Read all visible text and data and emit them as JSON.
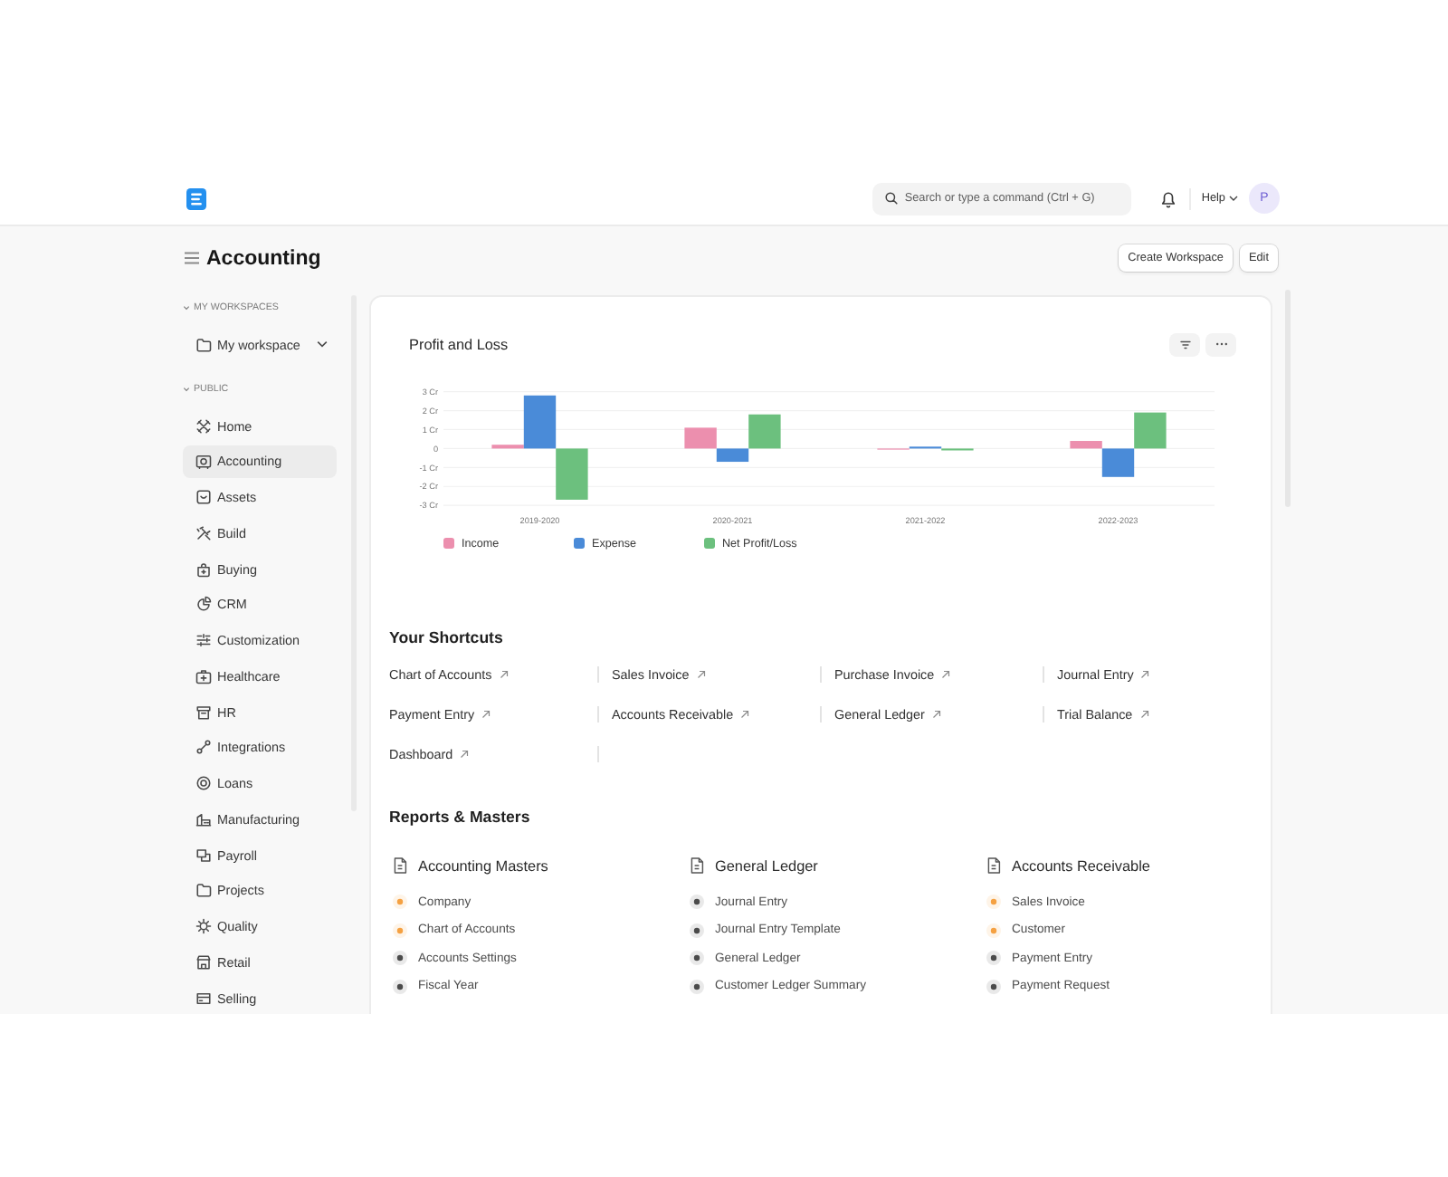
{
  "navbar": {
    "search": {
      "placeholder": "Search or type a command (Ctrl + G)"
    },
    "help": "Help",
    "avatar": "P"
  },
  "page_head": {
    "title": "Accounting",
    "buttons": [
      "Create Workspace",
      "Edit"
    ]
  },
  "sidebar": {
    "sections": [
      {
        "label": "MY WORKSPACES",
        "kind": "folders",
        "expanded": true,
        "items": [
          {
            "label": "My workspace",
            "selected": false,
            "expanded": false
          }
        ]
      },
      {
        "label": "PUBLIC",
        "kind": "modules",
        "expanded": true,
        "items": [
          {
            "label": "Home",
            "selected": false
          },
          {
            "label": "Accounting",
            "selected": true
          },
          {
            "label": "Assets",
            "selected": false
          },
          {
            "label": "Build",
            "selected": false
          },
          {
            "label": "Buying",
            "selected": false
          },
          {
            "label": "CRM",
            "selected": false
          },
          {
            "label": "Customization",
            "selected": false
          },
          {
            "label": "Healthcare",
            "selected": false
          },
          {
            "label": "HR",
            "selected": false
          },
          {
            "label": "Integrations",
            "selected": false
          },
          {
            "label": "Loans",
            "selected": false
          },
          {
            "label": "Manufacturing",
            "selected": false
          },
          {
            "label": "Payroll",
            "selected": false
          },
          {
            "label": "Projects",
            "selected": false
          },
          {
            "label": "Quality",
            "selected": false
          },
          {
            "label": "Retail",
            "selected": false
          },
          {
            "label": "Selling",
            "selected": false
          }
        ]
      }
    ]
  },
  "workspace": {
    "chart_widget": {
      "chart_data": {
        "type": "bar",
        "title": "Profit and Loss",
        "categories": [
          "2019-2020",
          "2020-2021",
          "2021-2022",
          "2022-2023"
        ],
        "series": [
          {
            "name": "Income",
            "color": "#ec8fae",
            "values": [
              0.2,
              1.1,
              0.0,
              0.4
            ]
          },
          {
            "name": "Expense",
            "color": "#4a8bd8",
            "values": [
              2.8,
              -0.7,
              0.1,
              -1.5
            ]
          },
          {
            "name": "Net Profit/Loss",
            "color": "#6cc07e",
            "values": [
              -2.7,
              1.8,
              -0.1,
              1.9
            ]
          }
        ],
        "ylim": [
          -3,
          3
        ],
        "yticks": [
          {
            "value": 3,
            "label": "3 Cr"
          },
          {
            "value": 2,
            "label": "2 Cr"
          },
          {
            "value": 1,
            "label": "1 Cr"
          },
          0,
          {
            "value": -1,
            "label": "-1 Cr"
          },
          {
            "value": -2,
            "label": "-2 Cr"
          },
          {
            "value": -3,
            "label": "-3 Cr"
          }
        ],
        "grid": true
      }
    },
    "shortcuts": {
      "title": "Your Shortcuts",
      "items": [
        "Chart of Accounts",
        "Sales Invoice",
        "Purchase Invoice",
        "Journal Entry",
        "Payment Entry",
        "Accounts Receivable",
        "General Ledger",
        "Trial Balance",
        "Dashboard"
      ]
    },
    "reports": {
      "title": "Reports & Masters",
      "cards": [
        {
          "title": "Accounting Masters",
          "links": [
            {
              "label": "Company",
              "color": "#f5a142"
            },
            {
              "label": "Chart of Accounts",
              "color": "#f5a142"
            },
            {
              "label": "Accounts Settings",
              "color": "#4b4b4b"
            },
            {
              "label": "Fiscal Year",
              "color": "#4b4b4b"
            }
          ]
        },
        {
          "title": "General Ledger",
          "links": [
            {
              "label": "Journal Entry",
              "color": "#4b4b4b"
            },
            {
              "label": "Journal Entry Template",
              "color": "#4b4b4b"
            },
            {
              "label": "General Ledger",
              "color": "#4b4b4b"
            },
            {
              "label": "Customer Ledger Summary",
              "color": "#4b4b4b"
            }
          ]
        },
        {
          "title": "Accounts Receivable",
          "links": [
            {
              "label": "Sales Invoice",
              "color": "#f5a142"
            },
            {
              "label": "Customer",
              "color": "#f5a142"
            },
            {
              "label": "Payment Entry",
              "color": "#4b4b4b"
            },
            {
              "label": "Payment Request",
              "color": "#4b4b4b"
            }
          ]
        }
      ]
    }
  }
}
